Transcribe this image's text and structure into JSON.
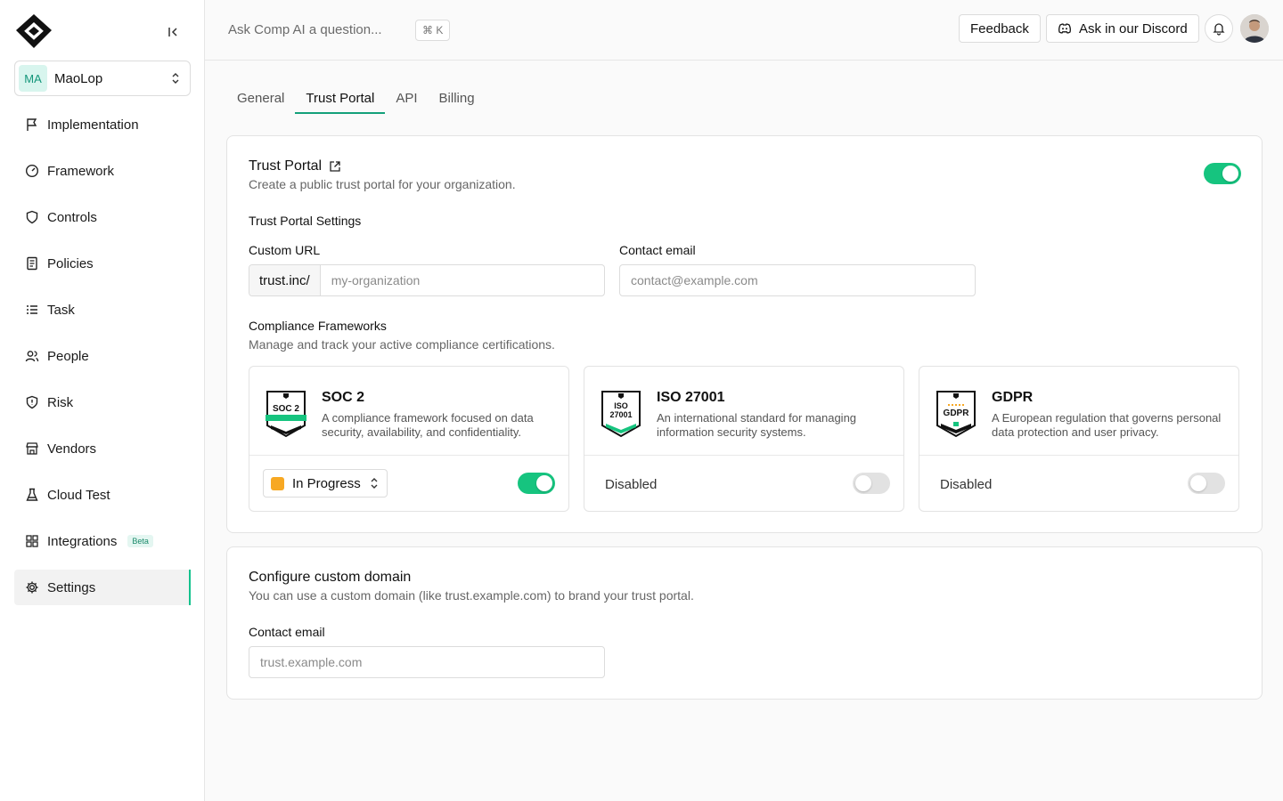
{
  "sidebar": {
    "org": {
      "initials": "MA",
      "name": "MaoLop"
    },
    "items": [
      {
        "label": "Implementation",
        "icon": "flag-icon"
      },
      {
        "label": "Framework",
        "icon": "gauge-icon"
      },
      {
        "label": "Controls",
        "icon": "shield-icon"
      },
      {
        "label": "Policies",
        "icon": "document-icon"
      },
      {
        "label": "Task",
        "icon": "list-icon"
      },
      {
        "label": "People",
        "icon": "people-icon"
      },
      {
        "label": "Risk",
        "icon": "shield-alert-icon"
      },
      {
        "label": "Vendors",
        "icon": "store-icon"
      },
      {
        "label": "Cloud Test",
        "icon": "flask-icon"
      },
      {
        "label": "Integrations",
        "icon": "grid-icon",
        "badge": "Beta"
      },
      {
        "label": "Settings",
        "icon": "gear-icon",
        "active": true
      }
    ]
  },
  "topbar": {
    "ask_placeholder": "Ask Comp AI a question...",
    "shortcut": "⌘ K",
    "feedback_label": "Feedback",
    "discord_label": "Ask in our Discord"
  },
  "tabs": [
    {
      "label": "General"
    },
    {
      "label": "Trust Portal",
      "active": true
    },
    {
      "label": "API"
    },
    {
      "label": "Billing"
    }
  ],
  "trust_portal": {
    "title": "Trust Portal",
    "subtitle": "Create a public trust portal for your organization.",
    "enabled": true,
    "settings_heading": "Trust Portal Settings",
    "custom_url_label": "Custom URL",
    "custom_url_prefix": "trust.inc/",
    "custom_url_placeholder": "my-organization",
    "contact_email_label": "Contact email",
    "contact_email_placeholder": "contact@example.com",
    "frameworks_heading": "Compliance Frameworks",
    "frameworks_subtitle": "Manage and track your active compliance certifications.",
    "frameworks": [
      {
        "name": "SOC 2",
        "badge_text": "SOC 2",
        "description": "A compliance framework focused on data security, availability, and confidentiality.",
        "status": "In Progress",
        "status_color": "#f7a823",
        "enabled": true
      },
      {
        "name": "ISO 27001",
        "badge_text_1": "ISO",
        "badge_text_2": "27001",
        "description": "An international standard for managing information security systems.",
        "status": "Disabled",
        "enabled": false
      },
      {
        "name": "GDPR",
        "badge_text": "GDPR",
        "description": "A European regulation that governs personal data protection and user privacy.",
        "status": "Disabled",
        "enabled": false
      }
    ]
  },
  "custom_domain": {
    "title": "Configure custom domain",
    "subtitle": "You can use a custom domain (like trust.example.com) to brand your trust portal.",
    "field_label": "Contact email",
    "field_placeholder": "trust.example.com"
  },
  "colors": {
    "accent": "#16c47f",
    "tab_underline": "#13a07a"
  }
}
